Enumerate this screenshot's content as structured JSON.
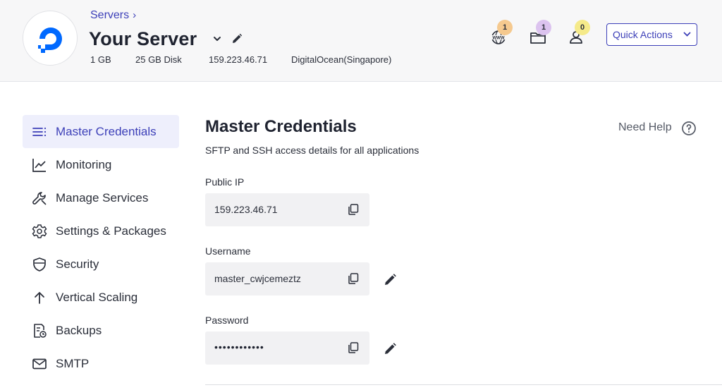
{
  "header": {
    "breadcrumb": "Servers",
    "title": "Your Server",
    "specs": {
      "ram": "1 GB",
      "disk": "25 GB Disk",
      "ip": "159.223.46.71",
      "provider": "DigitalOcean(Singapore)"
    },
    "badges": {
      "www": "1",
      "folder": "1",
      "user": "0"
    },
    "badge_colors": {
      "www": "#f5c98f",
      "folder": "#dcc3ef",
      "user": "#f5ea8a"
    },
    "quick_actions_label": "Quick Actions"
  },
  "sidebar": {
    "items": [
      {
        "label": "Master Credentials",
        "icon": "list-icon",
        "active": true
      },
      {
        "label": "Monitoring",
        "icon": "chart-line-icon",
        "active": false
      },
      {
        "label": "Manage Services",
        "icon": "wrench-icon",
        "active": false
      },
      {
        "label": "Settings & Packages",
        "icon": "gear-icon",
        "active": false
      },
      {
        "label": "Security",
        "icon": "shield-icon",
        "active": false
      },
      {
        "label": "Vertical Scaling",
        "icon": "arrow-up-icon",
        "active": false
      },
      {
        "label": "Backups",
        "icon": "backup-icon",
        "active": false
      },
      {
        "label": "SMTP",
        "icon": "mail-icon",
        "active": false
      }
    ]
  },
  "main": {
    "title": "Master Credentials",
    "subtitle": "SFTP and SSH access details for all applications",
    "help_label": "Need Help",
    "fields": {
      "public_ip": {
        "label": "Public IP",
        "value": "159.223.46.71"
      },
      "username": {
        "label": "Username",
        "value": "master_cwjcemeztz"
      },
      "password": {
        "label": "Password",
        "value": "••••••••••••"
      }
    }
  },
  "colors": {
    "accent": "#3c3fb8",
    "active_bg": "#eeeffc",
    "field_bg": "#f1f1f3",
    "header_bg": "#f7f7f8",
    "brand_blue": "#0069ff"
  }
}
